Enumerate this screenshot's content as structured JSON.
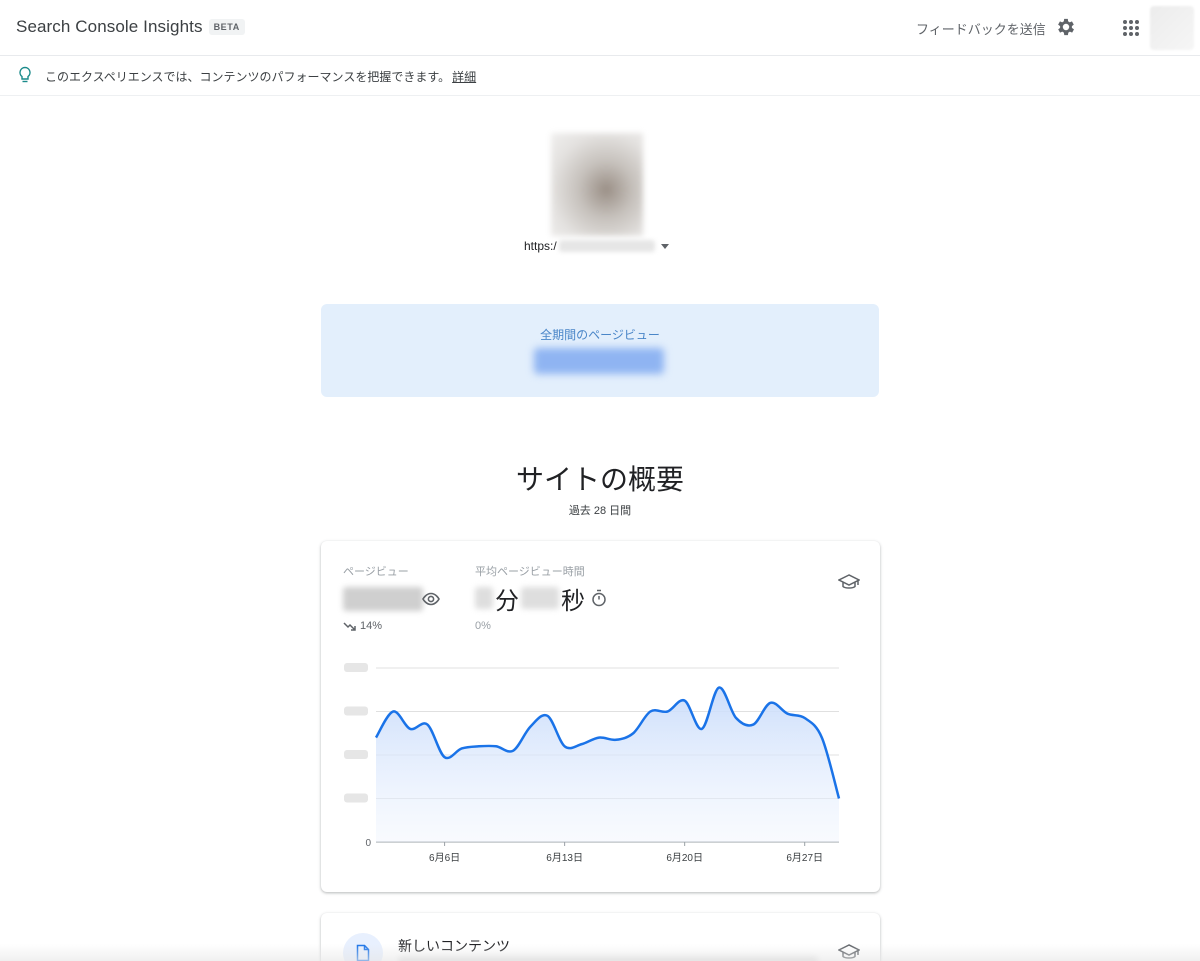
{
  "header": {
    "title": "Search Console Insights",
    "badge": "BETA",
    "feedback": "フィードバックを送信"
  },
  "infobar": {
    "text": "このエクスペリエンスでは、コンテンツのパフォーマンスを把握できます。",
    "link": "詳細"
  },
  "site": {
    "url_prefix": "https:/"
  },
  "total": {
    "label": "全期間のページビュー"
  },
  "overview": {
    "title": "サイトの概要",
    "subtitle": "過去 28 日間",
    "metric1": {
      "label": "ページビュー",
      "change": "14%"
    },
    "metric2": {
      "label": "平均ページビュー時間",
      "minutes_unit": "分",
      "seconds_unit": "秒",
      "change": "0%"
    }
  },
  "chart_data": {
    "type": "area",
    "x_tick_labels": [
      "6月6日",
      "6月13日",
      "6月20日",
      "6月27日"
    ],
    "y_tick_labels": [
      "0"
    ],
    "ylim": [
      0,
      4
    ],
    "grid": true,
    "color": "#1a73e8",
    "values": [
      2.4,
      3.0,
      2.6,
      2.7,
      1.95,
      2.15,
      2.2,
      2.2,
      2.1,
      2.65,
      2.9,
      2.2,
      2.25,
      2.4,
      2.35,
      2.5,
      3.0,
      3.0,
      3.25,
      2.6,
      3.55,
      2.85,
      2.7,
      3.2,
      2.95,
      2.85,
      2.4,
      1.0
    ],
    "tick_indices": [
      4,
      11,
      18,
      25
    ]
  },
  "new_content": {
    "title": "新しいコンテンツ"
  },
  "icons": {
    "gear": "gear-icon",
    "apps": "apps-grid-icon",
    "bulb": "lightbulb-icon",
    "eye": "eye-icon",
    "timer": "timer-icon",
    "hat": "graduation-cap-icon",
    "doc": "document-icon",
    "trend": "trending-down-icon"
  }
}
